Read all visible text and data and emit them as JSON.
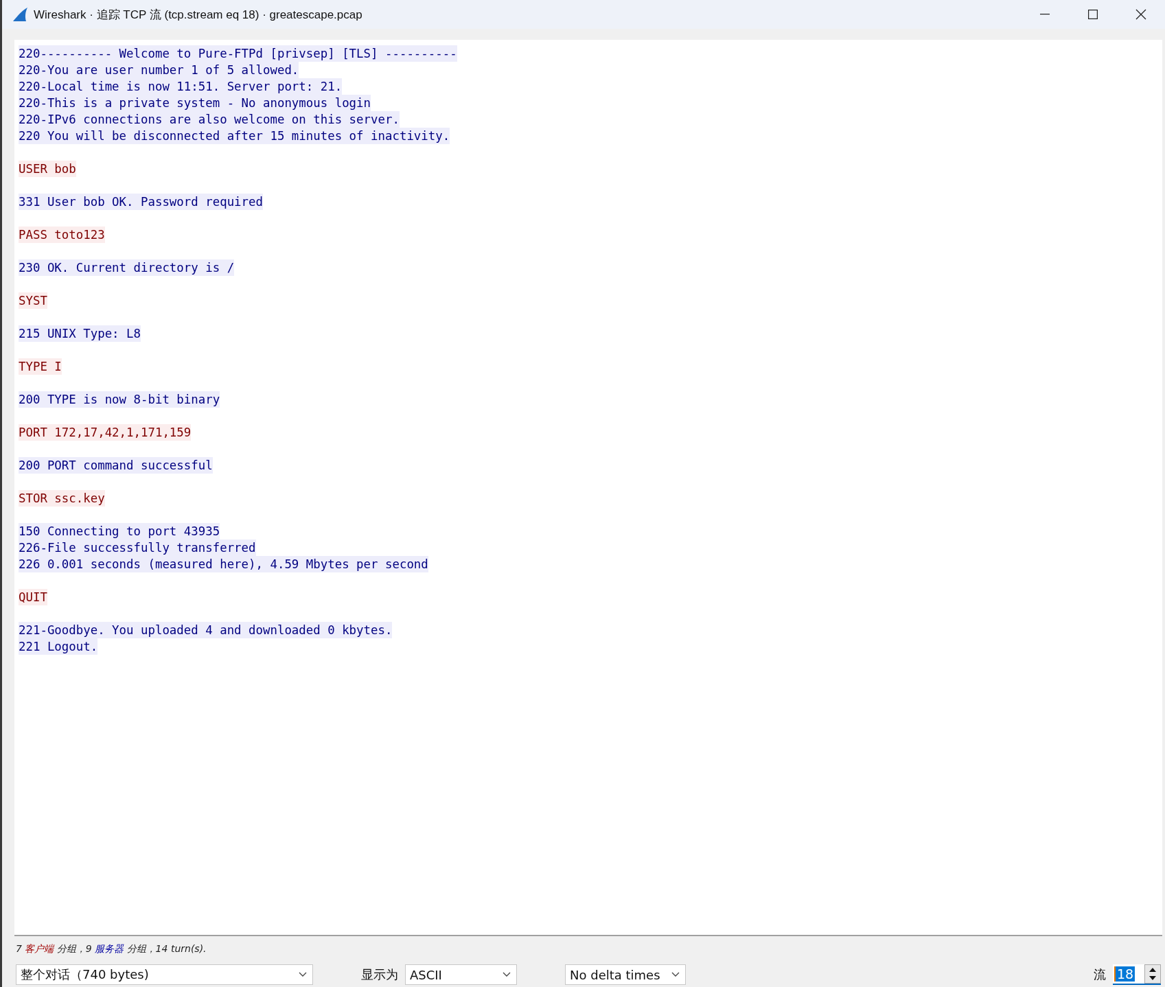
{
  "window": {
    "title": "Wireshark · 追踪 TCP 流 (tcp.stream eq 18) · greatescape.pcap"
  },
  "stream": [
    {
      "kind": "server",
      "lines": [
        "220---------- Welcome to Pure-FTPd [privsep] [TLS] ----------",
        "220-You are user number 1 of 5 allowed.",
        "220-Local time is now 11:51. Server port: 21.",
        "220-This is a private system - No anonymous login",
        "220-IPv6 connections are also welcome on this server.",
        "220 You will be disconnected after 15 minutes of inactivity."
      ]
    },
    {
      "kind": "client",
      "lines": [
        "USER bob"
      ]
    },
    {
      "kind": "server",
      "lines": [
        "331 User bob OK. Password required"
      ]
    },
    {
      "kind": "client",
      "lines": [
        "PASS toto123"
      ]
    },
    {
      "kind": "server",
      "lines": [
        "230 OK. Current directory is /"
      ]
    },
    {
      "kind": "client",
      "lines": [
        "SYST"
      ]
    },
    {
      "kind": "server",
      "lines": [
        "215 UNIX Type: L8"
      ]
    },
    {
      "kind": "client",
      "lines": [
        "TYPE I"
      ]
    },
    {
      "kind": "server",
      "lines": [
        "200 TYPE is now 8-bit binary"
      ]
    },
    {
      "kind": "client",
      "lines": [
        "PORT 172,17,42,1,171,159"
      ]
    },
    {
      "kind": "server",
      "lines": [
        "200 PORT command successful"
      ]
    },
    {
      "kind": "client",
      "lines": [
        "STOR ssc.key"
      ]
    },
    {
      "kind": "server",
      "lines": [
        "150 Connecting to port 43935",
        "226-File successfully transferred",
        "226 0.001 seconds (measured here), 4.59 Mbytes per second"
      ]
    },
    {
      "kind": "client",
      "lines": [
        "QUIT"
      ]
    },
    {
      "kind": "server",
      "lines": [
        "221-Goodbye. You uploaded 4 and downloaded 0 kbytes.",
        "221 Logout."
      ]
    }
  ],
  "summary": [
    {
      "kind": "plain",
      "text": "7 "
    },
    {
      "kind": "client",
      "text": "客户端"
    },
    {
      "kind": "plain",
      "text": " 分组，9 "
    },
    {
      "kind": "server",
      "text": "服务器"
    },
    {
      "kind": "plain",
      "text": " 分组，14 turn(s)."
    }
  ],
  "controls": {
    "conversation": "整个对话（740 bytes)",
    "show_as_label": "显示为",
    "show_as": "ASCII",
    "delta": "No delta times",
    "stream_label": "流",
    "stream_value": "18"
  }
}
